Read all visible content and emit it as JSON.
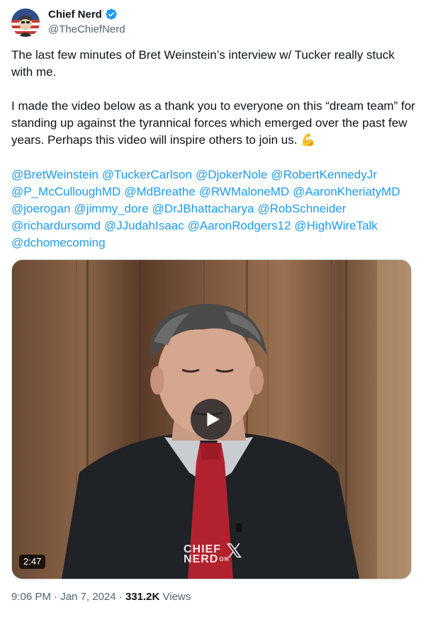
{
  "author": {
    "name": "Chief Nerd",
    "handle": "@TheChiefNerd",
    "verified": true,
    "verified_color": "#1d9bf0"
  },
  "tweet": {
    "paragraph1": "The last few minutes of Bret Weinstein’s interview w/ Tucker really stuck with me.",
    "paragraph2": "I made the video below as a thank you to everyone on this “dream team” for standing up against the tyrannical forces which emerged over the past few years. Perhaps this video will inspire others to join us.",
    "emoji": "💪",
    "mention_lines": [
      [
        "@BretWeinstein",
        "@TuckerCarlson",
        "@DjokerNole",
        "@RobertKennedyJr"
      ],
      [
        "@P_McCulloughMD",
        "@MdBreathe",
        "@RWMaloneMD",
        "@AaronKheriatyMD"
      ],
      [
        "@joerogan",
        "@jimmy_dore",
        "@DrJBhattacharya",
        "@RobSchneider"
      ],
      [
        "@richardursomd",
        "@JJudahIsaac",
        "@AaronRodgers12",
        "@HighWireTalk"
      ],
      [
        "@dchomecoming"
      ]
    ],
    "link_color": "#1d9bf0"
  },
  "video": {
    "duration": "2:47",
    "watermark_line1": "CHIEF",
    "watermark_line2": "NERD",
    "watermark_on": "ON",
    "watermark_x": "𝕏"
  },
  "meta": {
    "time": "9:06 PM",
    "separator": "·",
    "date": "Jan 7, 2024",
    "views_count": "331.2K",
    "views_label": "Views"
  }
}
